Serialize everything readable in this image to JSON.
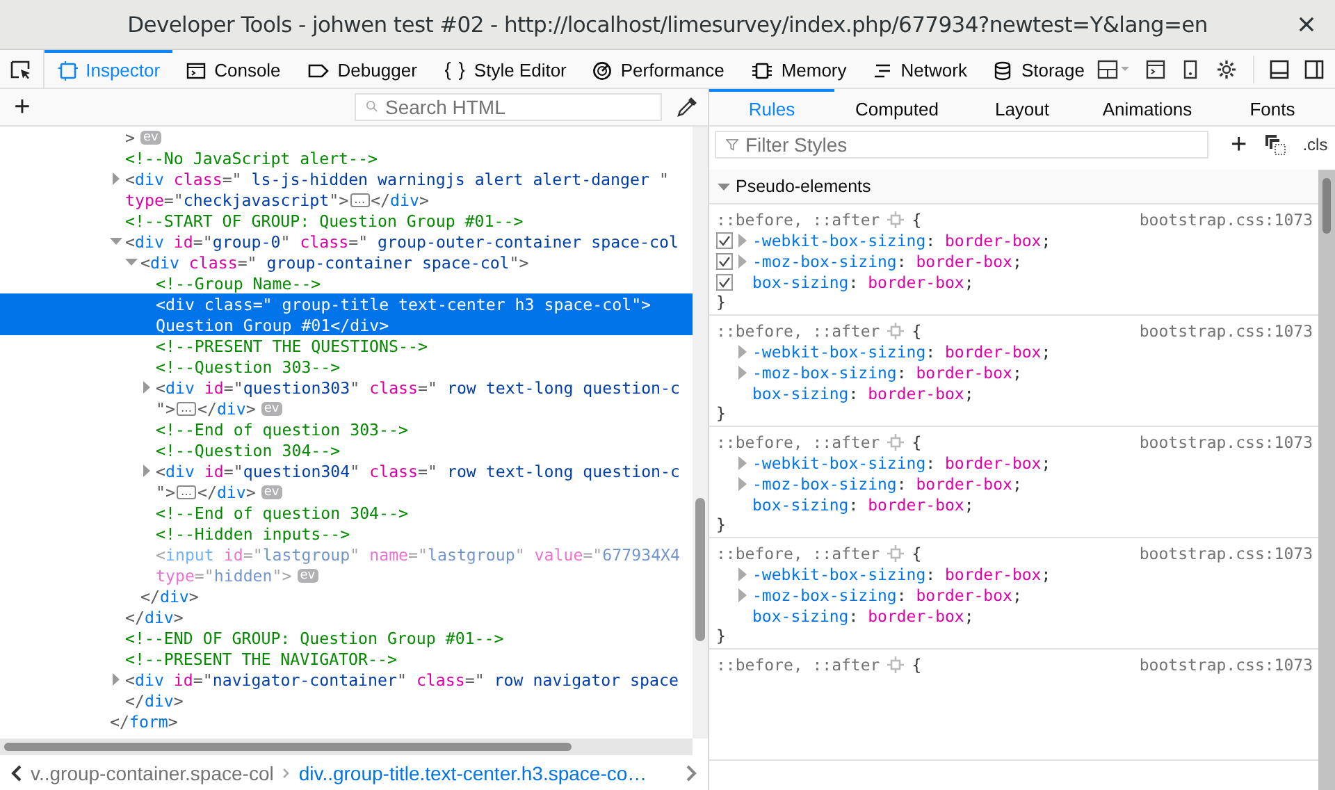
{
  "window": {
    "title": "Developer Tools - johwen test #02 - http://localhost/limesurvey/index.php/677934?newtest=Y&lang=en"
  },
  "toolbar": {
    "tabs": [
      {
        "label": "Inspector",
        "selected": true
      },
      {
        "label": "Console",
        "selected": false
      },
      {
        "label": "Debugger",
        "selected": false
      },
      {
        "label": "Style Editor",
        "selected": false
      },
      {
        "label": "Performance",
        "selected": false
      },
      {
        "label": "Memory",
        "selected": false
      },
      {
        "label": "Network",
        "selected": false
      },
      {
        "label": "Storage",
        "selected": false
      }
    ]
  },
  "markup_toolbar": {
    "add_button": "+",
    "search": {
      "placeholder": "Search HTML"
    }
  },
  "markup": {
    "children": [
      {
        "kind": "element",
        "lines": [
          [
            {
              "kind": "punct",
              "text": ">"
            },
            {
              "kind": "ev",
              "text": "ev"
            }
          ]
        ]
      },
      {
        "kind": "comment",
        "text": "<!--No JavaScript alert-->"
      },
      {
        "kind": "element",
        "expanded": false,
        "lines": [
          [
            {
              "kind": "punct",
              "text": "<"
            },
            {
              "kind": "tag",
              "text": "div"
            },
            {
              "kind": "attr",
              "text": " class"
            },
            {
              "kind": "punct",
              "text": "=\""
            },
            {
              "kind": "val",
              "text": " ls-js-hidden warningjs alert alert-danger "
            },
            {
              "kind": "punct",
              "text": "\""
            }
          ],
          [
            {
              "kind": "attr",
              "text": "type"
            },
            {
              "kind": "punct",
              "text": "=\""
            },
            {
              "kind": "val",
              "text": "checkjavascript"
            },
            {
              "kind": "punct",
              "text": "\">"
            },
            {
              "kind": "more",
              "text": "…"
            },
            {
              "kind": "punct",
              "text": "</"
            },
            {
              "kind": "tag",
              "text": "div"
            },
            {
              "kind": "punct",
              "text": ">"
            }
          ]
        ]
      },
      {
        "kind": "comment",
        "text": "<!--START OF GROUP: Question Group #01-->"
      },
      {
        "kind": "element",
        "expanded": true,
        "lines": [
          [
            {
              "kind": "punct",
              "text": "<"
            },
            {
              "kind": "tag",
              "text": "div"
            },
            {
              "kind": "attr",
              "text": " id"
            },
            {
              "kind": "punct",
              "text": "=\""
            },
            {
              "kind": "val",
              "text": "group-0"
            },
            {
              "kind": "punct",
              "text": "\""
            },
            {
              "kind": "attr",
              "text": " class"
            },
            {
              "kind": "punct",
              "text": "=\""
            },
            {
              "kind": "val",
              "text": " group-outer-container space-col"
            }
          ]
        ],
        "children": [
          {
            "kind": "element",
            "expanded": true,
            "lines": [
              [
                {
                  "kind": "punct",
                  "text": "<"
                },
                {
                  "kind": "tag",
                  "text": "div"
                },
                {
                  "kind": "attr",
                  "text": " class"
                },
                {
                  "kind": "punct",
                  "text": "=\""
                },
                {
                  "kind": "val",
                  "text": " group-container space-col"
                },
                {
                  "kind": "punct",
                  "text": "\">"
                }
              ]
            ],
            "children": [
              {
                "kind": "comment",
                "text": "<!--Group Name-->"
              },
              {
                "kind": "element",
                "selected": true,
                "lines": [
                  [
                    {
                      "kind": "punct",
                      "text": "<"
                    },
                    {
                      "kind": "tag",
                      "text": "div"
                    },
                    {
                      "kind": "attr",
                      "text": " class"
                    },
                    {
                      "kind": "punct",
                      "text": "=\""
                    },
                    {
                      "kind": "val",
                      "text": " group-title text-center h3 space-col"
                    },
                    {
                      "kind": "punct",
                      "text": "\">"
                    }
                  ],
                  [
                    {
                      "kind": "text",
                      "text": "Question Group #01"
                    },
                    {
                      "kind": "punct",
                      "text": "</"
                    },
                    {
                      "kind": "tag",
                      "text": "div"
                    },
                    {
                      "kind": "punct",
                      "text": ">"
                    }
                  ]
                ]
              },
              {
                "kind": "comment",
                "text": "<!--PRESENT THE QUESTIONS-->"
              },
              {
                "kind": "comment",
                "text": "<!--Question 303-->"
              },
              {
                "kind": "element",
                "expanded": false,
                "lines": [
                  [
                    {
                      "kind": "punct",
                      "text": "<"
                    },
                    {
                      "kind": "tag",
                      "text": "div"
                    },
                    {
                      "kind": "attr",
                      "text": " id"
                    },
                    {
                      "kind": "punct",
                      "text": "=\""
                    },
                    {
                      "kind": "val",
                      "text": "question303"
                    },
                    {
                      "kind": "punct",
                      "text": "\""
                    },
                    {
                      "kind": "attr",
                      "text": " class"
                    },
                    {
                      "kind": "punct",
                      "text": "=\""
                    },
                    {
                      "kind": "val",
                      "text": " row text-long question-c"
                    }
                  ],
                  [
                    {
                      "kind": "punct",
                      "text": "\">"
                    },
                    {
                      "kind": "more",
                      "text": "…"
                    },
                    {
                      "kind": "punct",
                      "text": "</"
                    },
                    {
                      "kind": "tag",
                      "text": "div"
                    },
                    {
                      "kind": "punct",
                      "text": ">"
                    },
                    {
                      "kind": "ev",
                      "text": "ev"
                    }
                  ]
                ]
              },
              {
                "kind": "comment",
                "text": "<!--End of question 303-->"
              },
              {
                "kind": "comment",
                "text": "<!--Question 304-->"
              },
              {
                "kind": "element",
                "expanded": false,
                "lines": [
                  [
                    {
                      "kind": "punct",
                      "text": "<"
                    },
                    {
                      "kind": "tag",
                      "text": "div"
                    },
                    {
                      "kind": "attr",
                      "text": " id"
                    },
                    {
                      "kind": "punct",
                      "text": "=\""
                    },
                    {
                      "kind": "val",
                      "text": "question304"
                    },
                    {
                      "kind": "punct",
                      "text": "\""
                    },
                    {
                      "kind": "attr",
                      "text": " class"
                    },
                    {
                      "kind": "punct",
                      "text": "=\""
                    },
                    {
                      "kind": "val",
                      "text": " row text-long question-c"
                    }
                  ],
                  [
                    {
                      "kind": "punct",
                      "text": "\">"
                    },
                    {
                      "kind": "more",
                      "text": "…"
                    },
                    {
                      "kind": "punct",
                      "text": "</"
                    },
                    {
                      "kind": "tag",
                      "text": "div"
                    },
                    {
                      "kind": "punct",
                      "text": ">"
                    },
                    {
                      "kind": "ev",
                      "text": "ev"
                    }
                  ]
                ]
              },
              {
                "kind": "comment",
                "text": "<!--End of question 304-->"
              },
              {
                "kind": "comment",
                "text": "<!--Hidden inputs-->"
              },
              {
                "kind": "element",
                "hidden": true,
                "lines": [
                  [
                    {
                      "kind": "punct",
                      "text": "<"
                    },
                    {
                      "kind": "tag",
                      "text": "input"
                    },
                    {
                      "kind": "attr",
                      "text": " id"
                    },
                    {
                      "kind": "punct",
                      "text": "=\""
                    },
                    {
                      "kind": "val",
                      "text": "lastgroup"
                    },
                    {
                      "kind": "punct",
                      "text": "\""
                    },
                    {
                      "kind": "attr",
                      "text": " name"
                    },
                    {
                      "kind": "punct",
                      "text": "=\""
                    },
                    {
                      "kind": "val",
                      "text": "lastgroup"
                    },
                    {
                      "kind": "punct",
                      "text": "\""
                    },
                    {
                      "kind": "attr",
                      "text": " value"
                    },
                    {
                      "kind": "punct",
                      "text": "=\""
                    },
                    {
                      "kind": "val",
                      "text": "677934X4"
                    }
                  ],
                  [
                    {
                      "kind": "attr",
                      "text": "type"
                    },
                    {
                      "kind": "punct",
                      "text": "=\""
                    },
                    {
                      "kind": "val",
                      "text": "hidden"
                    },
                    {
                      "kind": "punct",
                      "text": "\">"
                    },
                    {
                      "kind": "ev",
                      "text": "ev"
                    }
                  ]
                ]
              }
            ],
            "close": [
              {
                "kind": "punct",
                "text": "</"
              },
              {
                "kind": "tag",
                "text": "div"
              },
              {
                "kind": "punct",
                "text": ">"
              }
            ]
          }
        ],
        "close": [
          {
            "kind": "punct",
            "text": "</"
          },
          {
            "kind": "tag",
            "text": "div"
          },
          {
            "kind": "punct",
            "text": ">"
          }
        ]
      },
      {
        "kind": "comment",
        "text": "<!--END OF GROUP: Question Group #01-->"
      },
      {
        "kind": "comment",
        "text": "<!--PRESENT THE NAVIGATOR-->"
      },
      {
        "kind": "element",
        "expanded": false,
        "lines": [
          [
            {
              "kind": "punct",
              "text": "<"
            },
            {
              "kind": "tag",
              "text": "div"
            },
            {
              "kind": "attr",
              "text": " id"
            },
            {
              "kind": "punct",
              "text": "=\""
            },
            {
              "kind": "val",
              "text": "navigator-container"
            },
            {
              "kind": "punct",
              "text": "\""
            },
            {
              "kind": "attr",
              "text": " class"
            },
            {
              "kind": "punct",
              "text": "=\""
            },
            {
              "kind": "val",
              "text": " row navigator space"
            }
          ]
        ],
        "close": [
          {
            "kind": "punct",
            "text": "</"
          },
          {
            "kind": "tag",
            "text": "div"
          },
          {
            "kind": "punct",
            "text": ">"
          }
        ]
      }
    ],
    "close": [
      {
        "kind": "punct",
        "text": "</"
      },
      {
        "kind": "tag",
        "text": "form"
      },
      {
        "kind": "punct",
        "text": ">"
      }
    ]
  },
  "breadcrumbs": [
    {
      "text": "v..group-container.space-col",
      "selected": false
    },
    {
      "text": "div..group-title.text-center.h3.space-co…",
      "selected": true
    }
  ],
  "sidebar": {
    "tabs": [
      {
        "label": "Rules",
        "selected": true
      },
      {
        "label": "Computed",
        "selected": false
      },
      {
        "label": "Layout",
        "selected": false
      },
      {
        "label": "Animations",
        "selected": false
      },
      {
        "label": "Fonts",
        "selected": false
      }
    ],
    "filter": {
      "placeholder": "Filter Styles"
    },
    "add_rule": "+",
    "classes_button": ".cls",
    "section": {
      "title": "Pseudo-elements",
      "expanded": true
    },
    "rules": [
      {
        "selector": "::before, ::after",
        "open_brace": "{",
        "source": "bootstrap.css:1073",
        "close_brace": "}",
        "declarations": [
          {
            "text": "-webkit-box-sizing: border-box;",
            "expandable": true,
            "checked": true
          },
          {
            "text": "-moz-box-sizing: border-box;",
            "expandable": true,
            "checked": true
          },
          {
            "text": "box-sizing: border-box;",
            "expandable": false,
            "checked": true
          }
        ]
      },
      {
        "selector": "::before, ::after",
        "open_brace": "{",
        "source": "bootstrap.css:1073",
        "close_brace": "}",
        "declarations": [
          {
            "text": "-webkit-box-sizing: border-box;",
            "expandable": true
          },
          {
            "text": "-moz-box-sizing: border-box;",
            "expandable": true
          },
          {
            "text": "box-sizing: border-box;",
            "expandable": false
          }
        ]
      },
      {
        "selector": "::before, ::after",
        "open_brace": "{",
        "source": "bootstrap.css:1073",
        "close_brace": "}",
        "declarations": [
          {
            "text": "-webkit-box-sizing: border-box;",
            "expandable": true
          },
          {
            "text": "-moz-box-sizing: border-box;",
            "expandable": true
          },
          {
            "text": "box-sizing: border-box;",
            "expandable": false
          }
        ]
      },
      {
        "selector": "::before, ::after",
        "open_brace": "{",
        "source": "bootstrap.css:1073",
        "close_brace": "}",
        "declarations": [
          {
            "text": "-webkit-box-sizing: border-box;",
            "expandable": true
          },
          {
            "text": "-moz-box-sizing: border-box;",
            "expandable": true
          },
          {
            "text": "box-sizing: border-box;",
            "expandable": false
          }
        ]
      },
      {
        "selector": "::before, ::after",
        "open_brace": "{",
        "source": "bootstrap.css:1073"
      }
    ]
  }
}
